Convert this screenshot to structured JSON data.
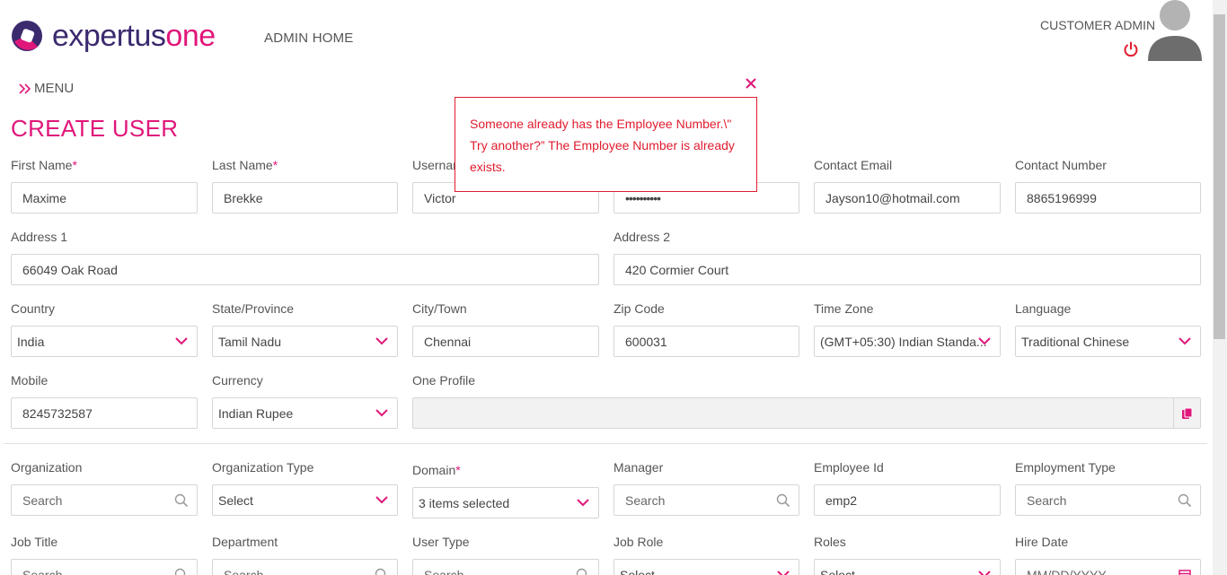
{
  "header": {
    "logo_a": "expertus",
    "logo_b": "one",
    "admin_home": "ADMIN HOME",
    "customer_admin": "CUSTOMER ADMIN"
  },
  "menu": {
    "label": "MENU"
  },
  "page_title": "CREATE USER",
  "popup": {
    "message": "Someone already has the Employee Number.\\\" Try another?” The Employee Number is already exists."
  },
  "form": {
    "first_name": {
      "label": "First Name",
      "value": "Maxime"
    },
    "last_name": {
      "label": "Last Name",
      "value": "Brekke"
    },
    "username": {
      "label": "Usernam",
      "value": "Victor"
    },
    "password": {
      "value": "••••••••••"
    },
    "contact_email": {
      "label": "Contact Email",
      "value": "Jayson10@hotmail.com"
    },
    "contact_number": {
      "label": "Contact Number",
      "value": "8865196999"
    },
    "address1": {
      "label": "Address 1",
      "value": "66049 Oak Road"
    },
    "address2": {
      "label": "Address 2",
      "value": "420 Cormier Court"
    },
    "country": {
      "label": "Country",
      "value": "India"
    },
    "state": {
      "label": "State/Province",
      "value": "Tamil Nadu"
    },
    "city": {
      "label": "City/Town",
      "value": "Chennai"
    },
    "zip": {
      "label": "Zip Code",
      "value": "600031"
    },
    "timezone": {
      "label": "Time Zone",
      "value": "(GMT+05:30) Indian Standa..."
    },
    "language": {
      "label": "Language",
      "value": "Traditional Chinese"
    },
    "mobile": {
      "label": "Mobile",
      "value": "8245732587"
    },
    "currency": {
      "label": "Currency",
      "value": "Indian Rupee"
    },
    "one_profile": {
      "label": "One Profile",
      "value": ""
    },
    "organization": {
      "label": "Organization",
      "placeholder": "Search"
    },
    "org_type": {
      "label": "Organization Type",
      "value": "Select"
    },
    "domain": {
      "label": "Domain",
      "value": "3 items selected"
    },
    "manager": {
      "label": "Manager",
      "placeholder": "Search"
    },
    "employee_id": {
      "label": "Employee Id",
      "value": "emp2"
    },
    "employment_type": {
      "label": "Employment Type",
      "placeholder": "Search"
    },
    "job_title": {
      "label": "Job Title",
      "placeholder": "Search"
    },
    "department": {
      "label": "Department",
      "placeholder": "Search"
    },
    "user_type": {
      "label": "User Type",
      "placeholder": "Search"
    },
    "job_role": {
      "label": "Job Role",
      "value": "Select"
    },
    "roles": {
      "label": "Roles",
      "value": "Select"
    },
    "hire_date": {
      "label": "Hire Date",
      "placeholder": "MM/DD/YYYY"
    }
  },
  "colors": {
    "accent": "#e0177a",
    "brand_dark": "#3b2a6e",
    "error": "#e01c2e"
  }
}
